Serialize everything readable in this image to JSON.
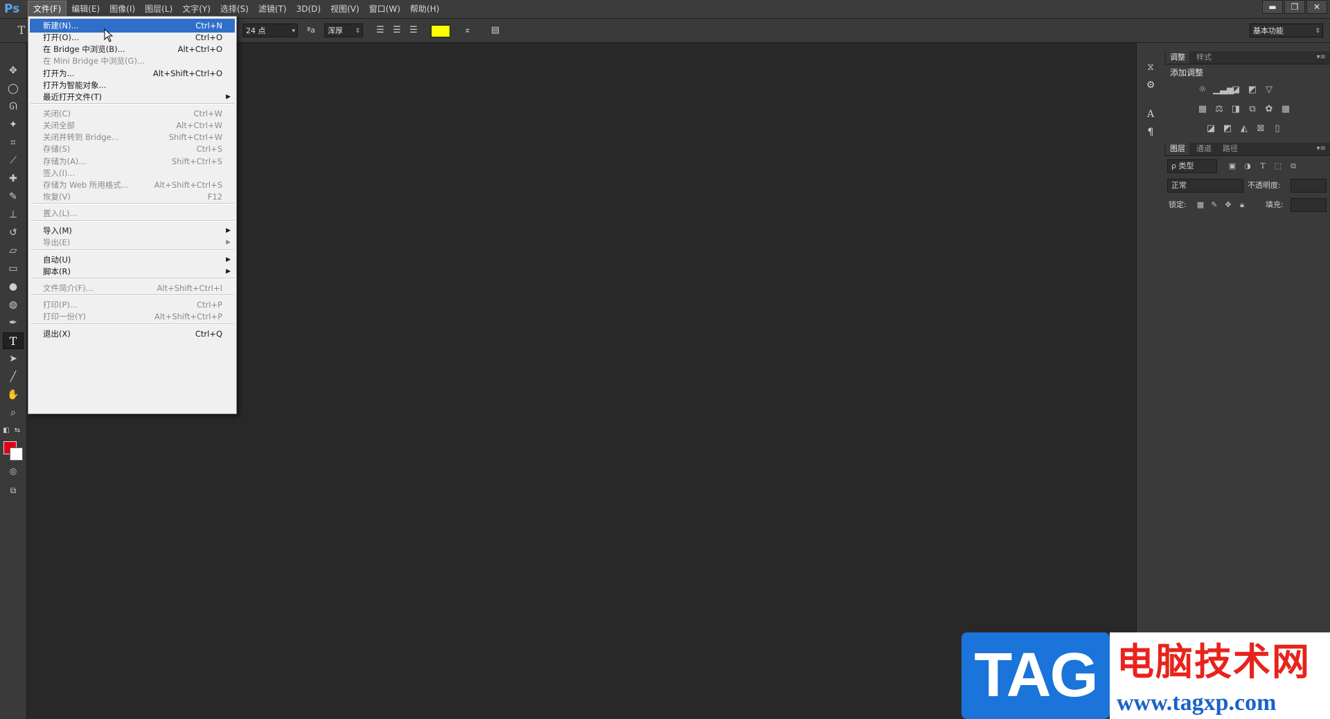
{
  "app": {
    "logo": "Ps"
  },
  "menubar": {
    "items": [
      "文件(F)",
      "编辑(E)",
      "图像(I)",
      "图层(L)",
      "文字(Y)",
      "选择(S)",
      "滤镜(T)",
      "3D(D)",
      "视图(V)",
      "窗口(W)",
      "帮助(H)"
    ],
    "active_index": 0
  },
  "window_controls": {
    "minimize": "▬",
    "restore": "❐",
    "close": "✕"
  },
  "options_bar": {
    "tool_glyph": "T",
    "font_size": "24 点",
    "aa_glyph": "ªa",
    "aa_mode": "浑厚",
    "text_color": "#ffff00",
    "workspace": "基本功能"
  },
  "file_menu": {
    "items": [
      {
        "label": "新建(N)...",
        "shortcut": "Ctrl+N",
        "enabled": true,
        "highlighted": true
      },
      {
        "label": "打开(O)...",
        "shortcut": "Ctrl+O",
        "enabled": true
      },
      {
        "label": "在 Bridge 中浏览(B)...",
        "shortcut": "Alt+Ctrl+O",
        "enabled": true
      },
      {
        "label": "在 Mini Bridge 中浏览(G)...",
        "shortcut": "",
        "enabled": false
      },
      {
        "label": "打开为...",
        "shortcut": "Alt+Shift+Ctrl+O",
        "enabled": true
      },
      {
        "label": "打开为智能对象...",
        "shortcut": "",
        "enabled": true
      },
      {
        "label": "最近打开文件(T)",
        "shortcut": "",
        "enabled": true,
        "submenu": true
      },
      {
        "label": "关闭(C)",
        "shortcut": "Ctrl+W",
        "enabled": false
      },
      {
        "label": "关闭全部",
        "shortcut": "Alt+Ctrl+W",
        "enabled": false
      },
      {
        "label": "关闭并转到 Bridge...",
        "shortcut": "Shift+Ctrl+W",
        "enabled": false
      },
      {
        "label": "存储(S)",
        "shortcut": "Ctrl+S",
        "enabled": false
      },
      {
        "label": "存储为(A)...",
        "shortcut": "Shift+Ctrl+S",
        "enabled": false
      },
      {
        "label": "签入(I)...",
        "shortcut": "",
        "enabled": false
      },
      {
        "label": "存储为 Web 所用格式...",
        "shortcut": "Alt+Shift+Ctrl+S",
        "enabled": false
      },
      {
        "label": "恢复(V)",
        "shortcut": "F12",
        "enabled": false
      },
      {
        "label": "置入(L)...",
        "shortcut": "",
        "enabled": false
      },
      {
        "label": "导入(M)",
        "shortcut": "",
        "enabled": true,
        "submenu": true
      },
      {
        "label": "导出(E)",
        "shortcut": "",
        "enabled": false,
        "submenu": true
      },
      {
        "label": "自动(U)",
        "shortcut": "",
        "enabled": true,
        "submenu": true
      },
      {
        "label": "脚本(R)",
        "shortcut": "",
        "enabled": true,
        "submenu": true
      },
      {
        "label": "文件简介(F)...",
        "shortcut": "Alt+Shift+Ctrl+I",
        "enabled": false
      },
      {
        "label": "打印(P)...",
        "shortcut": "Ctrl+P",
        "enabled": false
      },
      {
        "label": "打印一份(Y)",
        "shortcut": "Alt+Shift+Ctrl+P",
        "enabled": false
      },
      {
        "label": "退出(X)",
        "shortcut": "Ctrl+Q",
        "enabled": true
      }
    ],
    "submenu_arrow": "▶"
  },
  "adjustments_panel": {
    "tabs": [
      "调整",
      "样式"
    ],
    "title": "添加调整",
    "menu_glyph": "▾≡"
  },
  "layers_panel": {
    "tabs": [
      "图层",
      "通道",
      "路径"
    ],
    "filter_kind": "ρ 类型",
    "blend_mode": "正常",
    "opacity_label": "不透明度:",
    "lock_label": "锁定:",
    "fill_label": "填充:",
    "menu_glyph": "▾≡"
  },
  "watermark": {
    "tag": "TAG",
    "cn": "电脑技术网",
    "url": "www.tagxp.com"
  }
}
